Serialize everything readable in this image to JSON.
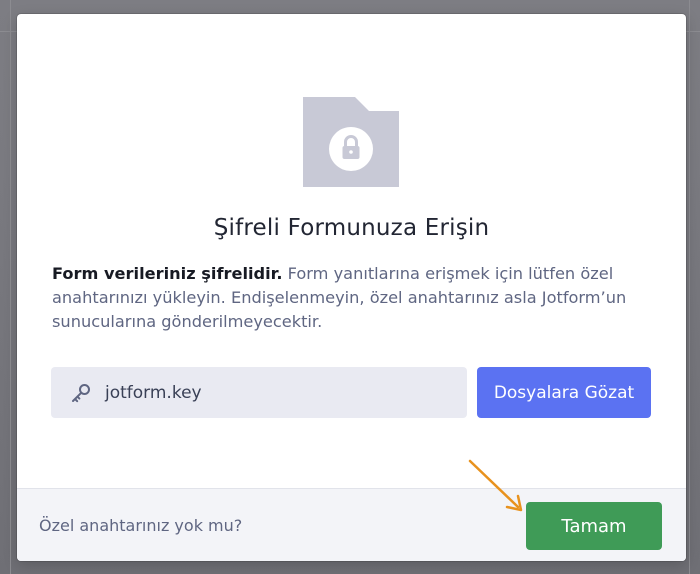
{
  "dialog": {
    "title": "Şifreli Formunuza Erişin",
    "description_bold": "Form verileriniz şifrelidir.",
    "description_text": " Form yanıtlarına erişmek için lütfen özel anahtarınızı yükleyin. Endişelenmeyin, özel anahtarınız asla Jotform’un sunucularına gönderilmeyecektir.",
    "icon": "locked-folder-icon"
  },
  "key_input": {
    "value": "jotform.key",
    "icon": "key-icon"
  },
  "browse_button": {
    "label": "Dosyalara Gözat"
  },
  "footer": {
    "link_text": "Özel anahtarınız yok mu?",
    "ok_label": "Tamam"
  },
  "colors": {
    "primary_blue": "#5b72f2",
    "success_green": "#3f9b57",
    "arrow_orange": "#e8921e",
    "folder_gray": "#c8c9d6"
  }
}
